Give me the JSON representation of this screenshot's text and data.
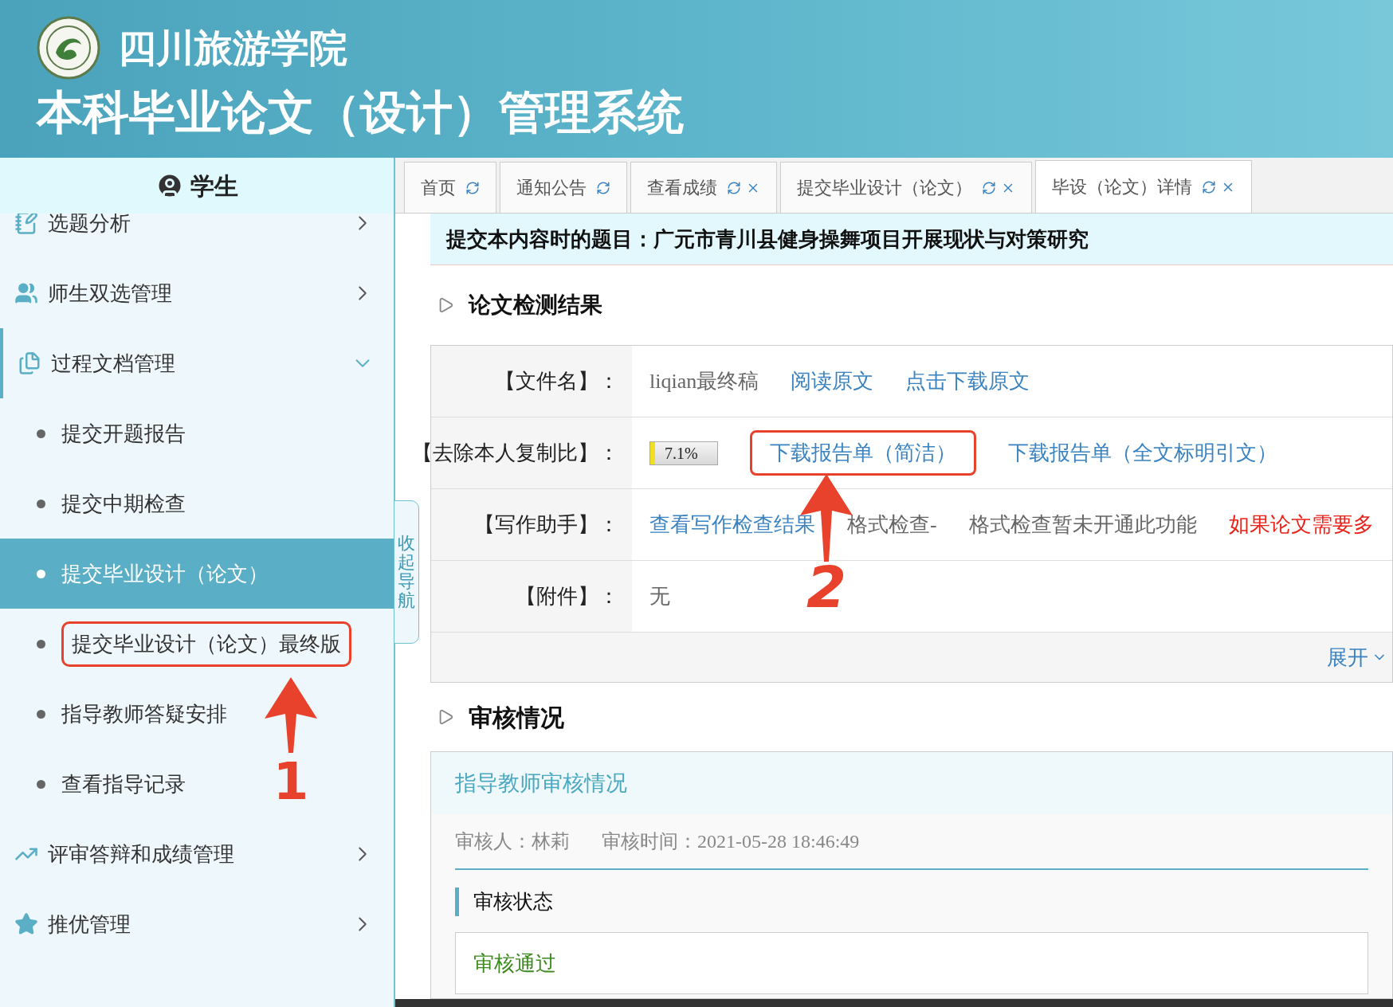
{
  "header": {
    "school": "四川旅游学院",
    "system": "本科毕业论文（设计）管理系统"
  },
  "sidebar": {
    "role": "学生",
    "collapse": "收起导航",
    "items": [
      {
        "label": "选题分析",
        "kind": "pen",
        "expanded": false
      },
      {
        "label": "师生双选管理",
        "kind": "people",
        "expanded": false
      },
      {
        "label": "过程文档管理",
        "kind": "docs",
        "expanded": true,
        "children": [
          {
            "label": "提交开题报告",
            "selected": false,
            "annotated": false
          },
          {
            "label": "提交中期检查",
            "selected": false,
            "annotated": false
          },
          {
            "label": "提交毕业设计（论文）",
            "selected": true,
            "annotated": false
          },
          {
            "label": "提交毕业设计（论文）最终版",
            "selected": false,
            "annotated": true
          },
          {
            "label": "指导教师答疑安排",
            "selected": false,
            "annotated": false
          },
          {
            "label": "查看指导记录",
            "selected": false,
            "annotated": false
          }
        ]
      },
      {
        "label": "评审答辩和成绩管理",
        "kind": "chart",
        "expanded": false
      },
      {
        "label": "推优管理",
        "kind": "star",
        "expanded": false
      }
    ]
  },
  "tabs": [
    {
      "label": "首页",
      "closable": false,
      "selected": false
    },
    {
      "label": "通知公告",
      "closable": false,
      "selected": false
    },
    {
      "label": "查看成绩",
      "closable": true,
      "selected": false
    },
    {
      "label": "提交毕业设计（论文）",
      "closable": true,
      "selected": false
    },
    {
      "label": "毕设（论文）详情",
      "closable": true,
      "selected": true
    }
  ],
  "topic": "提交本内容时的题目：广元市青川县健身操舞项目开展现状与对策研究",
  "check": {
    "heading": "论文检测结果",
    "rows": [
      {
        "label": "【文件名】：",
        "value": "liqian最终稿",
        "links": [
          {
            "text": "阅读原文",
            "annotated": false
          },
          {
            "text": "点击下载原文",
            "annotated": false
          }
        ]
      },
      {
        "label": "【去除本人复制比】：",
        "reading": "7.1%",
        "level": 0.071,
        "links": [
          {
            "text": "下载报告单（简洁）",
            "annotated": true
          },
          {
            "text": "下载报告单（全文标明引文）",
            "annotated": false
          }
        ]
      },
      {
        "label": "【写作助手】：",
        "links": [
          {
            "text": "查看写作检查结果",
            "annotated": false
          }
        ],
        "notes": [
          "格式检查-",
          "格式检查暂未开通此功能"
        ],
        "warning": "如果论文需要多"
      },
      {
        "label": "【附件】：",
        "value": "无"
      }
    ],
    "expand": "展开"
  },
  "review": {
    "heading": "审核情况",
    "card_title": "指导教师审核情况",
    "reviewer": "审核人：林莉",
    "time": "审核时间：2021-05-28 18:46:49",
    "status_heading": "审核状态",
    "status": "审核通过"
  },
  "annotations": [
    {
      "label": "1"
    },
    {
      "label": "2"
    }
  ]
}
